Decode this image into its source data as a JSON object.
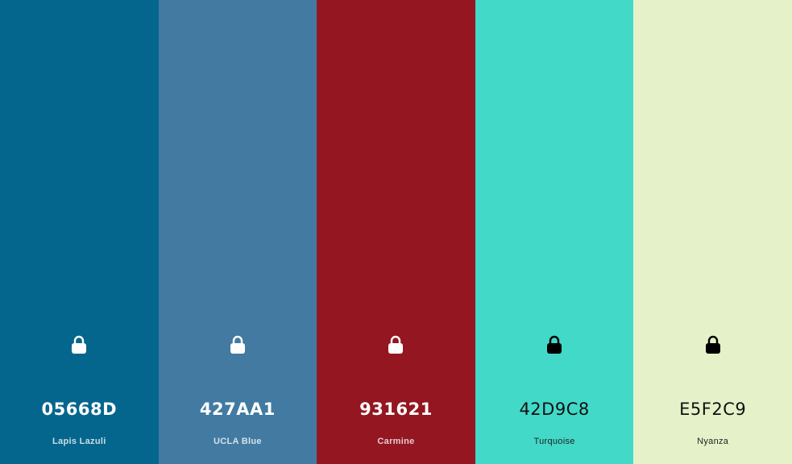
{
  "palette": {
    "swatches": [
      {
        "hex": "05668D",
        "name": "Lapis Lazuli",
        "color": "#05668D",
        "text_tone": "light",
        "lock_icon": "lock-icon"
      },
      {
        "hex": "427AA1",
        "name": "UCLA Blue",
        "color": "#427AA1",
        "text_tone": "light",
        "lock_icon": "lock-icon"
      },
      {
        "hex": "931621",
        "name": "Carmine",
        "color": "#931621",
        "text_tone": "light",
        "lock_icon": "lock-icon"
      },
      {
        "hex": "42D9C8",
        "name": "Turquoise",
        "color": "#42D9C8",
        "text_tone": "dark",
        "lock_icon": "lock-icon"
      },
      {
        "hex": "E5F2C9",
        "name": "Nyanza",
        "color": "#E5F2C9",
        "text_tone": "dark",
        "lock_icon": "lock-icon"
      }
    ]
  }
}
